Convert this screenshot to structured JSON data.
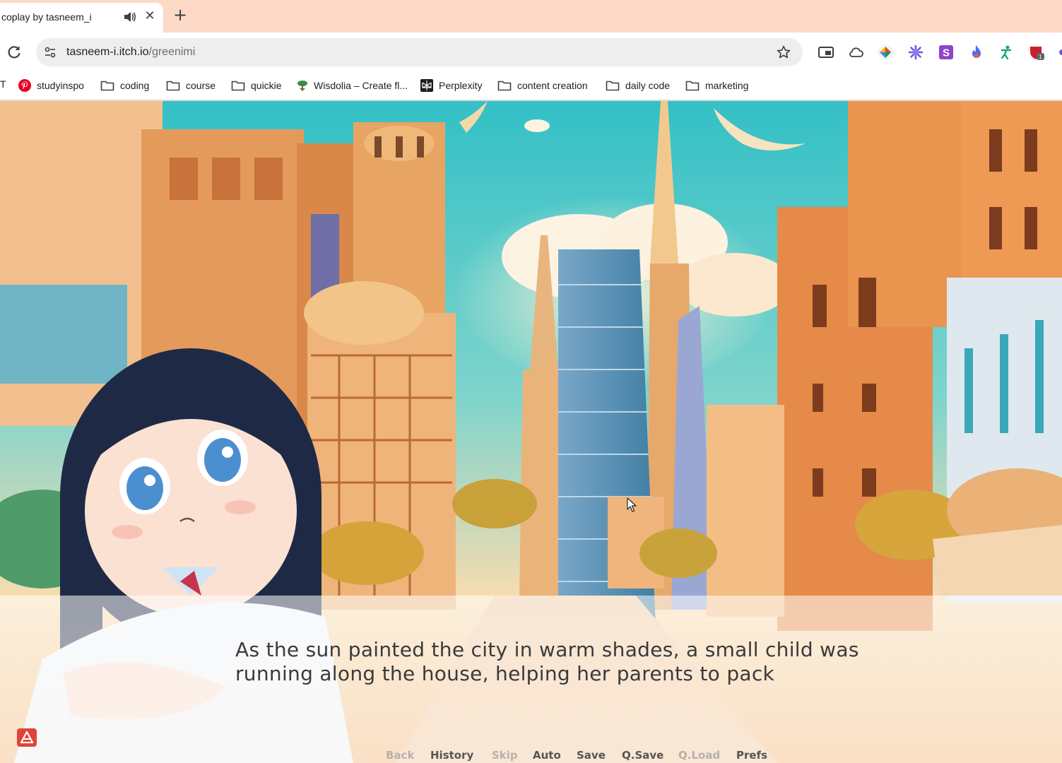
{
  "tab": {
    "title": "coplay by tasneem_i",
    "audio_icon": "speaker-icon",
    "close_glyph": "✕",
    "new_tab_glyph": "+"
  },
  "address_bar": {
    "domain": "tasneem-i.itch.io",
    "path": "/greenimi"
  },
  "bookmarks": {
    "cut_label": "T",
    "items": [
      {
        "label": "studyinspo",
        "icon": "pinterest-icon"
      },
      {
        "label": "coding",
        "icon": "folder-icon"
      },
      {
        "label": "course",
        "icon": "folder-icon"
      },
      {
        "label": "quickie",
        "icon": "folder-icon"
      },
      {
        "label": "Wisdolia – Create fl...",
        "icon": "wisdolia-icon"
      },
      {
        "label": "Perplexity",
        "icon": "perplexity-icon"
      },
      {
        "label": "content creation",
        "icon": "folder-icon"
      },
      {
        "label": "daily code",
        "icon": "folder-icon"
      },
      {
        "label": "marketing",
        "icon": "folder-icon"
      }
    ]
  },
  "extensions": {
    "badge_count": "1"
  },
  "game": {
    "dialogue": "As the sun painted the city in warm shades, a small child was running along the house, helping her parents to pack",
    "quick_menu": [
      {
        "label": "Back",
        "enabled": false
      },
      {
        "label": "History",
        "enabled": true
      },
      {
        "label": "Skip",
        "enabled": false
      },
      {
        "label": "Auto",
        "enabled": true
      },
      {
        "label": "Save",
        "enabled": true
      },
      {
        "label": "Q.Save",
        "enabled": true
      },
      {
        "label": "Q.Load",
        "enabled": false
      },
      {
        "label": "Prefs",
        "enabled": true
      }
    ]
  },
  "colors": {
    "tabstrip": "#fbd9c6",
    "sky": "#3fc6c4",
    "accent_orange": "#e8893a"
  }
}
